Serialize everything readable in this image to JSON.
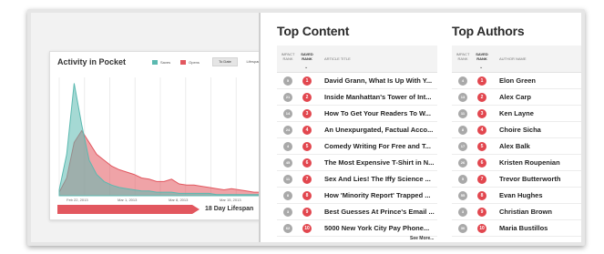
{
  "activity": {
    "title": "Activity in Pocket",
    "legend": [
      {
        "label": "Saves",
        "color": "#5bb9b0"
      },
      {
        "label": "Opens",
        "color": "#e2575f"
      }
    ],
    "btn_todate": "To Date",
    "btn_lifespan": "Lifespan",
    "lifespan_label": "18 Day Lifespan"
  },
  "chart_data": {
    "type": "area",
    "x_ticks": [
      "Feb 22, 2013",
      "Mar 1, 2013",
      "Mar 8, 2013",
      "Mar 15, 2013"
    ],
    "series": [
      {
        "name": "Saves",
        "color": "#5bb9b0",
        "values": [
          5,
          35,
          95,
          60,
          30,
          18,
          12,
          9,
          7,
          6,
          5,
          4,
          4,
          3,
          3,
          3,
          2,
          2,
          2,
          2,
          2,
          1,
          1,
          1,
          1,
          1,
          1,
          1
        ]
      },
      {
        "name": "Opens",
        "color": "#e2575f",
        "values": [
          3,
          15,
          45,
          55,
          45,
          35,
          30,
          25,
          22,
          20,
          18,
          15,
          14,
          12,
          12,
          14,
          10,
          9,
          9,
          8,
          7,
          6,
          5,
          6,
          5,
          4,
          3,
          3
        ]
      }
    ],
    "ylim": [
      0,
      100
    ]
  },
  "top_content": {
    "title": "Top Content",
    "col_impact": "IMPACT RANK",
    "col_saved": "SAVED RANK",
    "col_title": "ARTICLE TITLE",
    "rows": [
      {
        "impact": "5",
        "saved": "1",
        "title": "David Grann, What Is Up With Y..."
      },
      {
        "impact": "21",
        "saved": "2",
        "title": "Inside Manhattan's Tower of Int..."
      },
      {
        "impact": "14",
        "saved": "3",
        "title": "How To Get Your Readers To W..."
      },
      {
        "impact": "24",
        "saved": "4",
        "title": "An Unexpurgated, Factual Acco..."
      },
      {
        "impact": "4",
        "saved": "5",
        "title": "Comedy Writing For Free and T..."
      },
      {
        "impact": "45",
        "saved": "6",
        "title": "The Most Expensive T-Shirt in N..."
      },
      {
        "impact": "11",
        "saved": "7",
        "title": "Sex And Lies! The Iffy Science ..."
      },
      {
        "impact": "8",
        "saved": "8",
        "title": "How 'Minority Report' Trapped ..."
      },
      {
        "impact": "3",
        "saved": "9",
        "title": "Best Guesses At Prince's Email ..."
      },
      {
        "impact": "62",
        "saved": "10",
        "title": "5000 New York City Pay Phone..."
      }
    ],
    "see_more": "See More..."
  },
  "top_authors": {
    "title": "Top Authors",
    "col_impact": "IMPACT RANK",
    "col_saved": "SAVED RANK",
    "col_name": "AUTHOR NAME",
    "rows": [
      {
        "impact": "4",
        "saved": "1",
        "name": "Elon Green"
      },
      {
        "impact": "13",
        "saved": "2",
        "name": "Alex Carp"
      },
      {
        "impact": "11",
        "saved": "3",
        "name": "Ken Layne"
      },
      {
        "impact": "8",
        "saved": "4",
        "name": "Choire Sicha"
      },
      {
        "impact": "17",
        "saved": "5",
        "name": "Alex Balk"
      },
      {
        "impact": "26",
        "saved": "6",
        "name": "Kristen Roupenian"
      },
      {
        "impact": "5",
        "saved": "7",
        "name": "Trevor Butterworth"
      },
      {
        "impact": "55",
        "saved": "8",
        "name": "Evan Hughes"
      },
      {
        "impact": "3",
        "saved": "9",
        "name": "Christian Brown"
      },
      {
        "impact": "30",
        "saved": "10",
        "name": "Maria Bustillos"
      }
    ]
  }
}
